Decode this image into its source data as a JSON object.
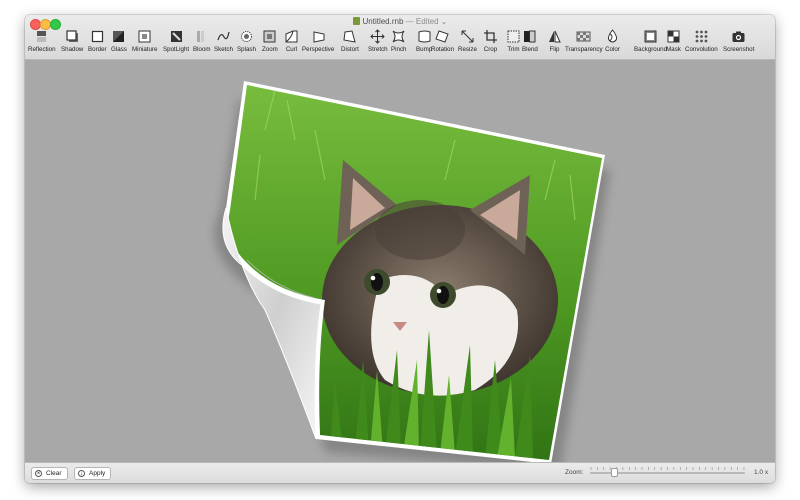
{
  "window": {
    "title": "Untitled.rnb",
    "status": "— Edited ⌄"
  },
  "toolbar": {
    "tools": [
      {
        "label": "Reflection",
        "icon": "reflection-icon"
      },
      {
        "label": "Shadow",
        "icon": "shadow-icon"
      },
      {
        "label": "Border",
        "icon": "border-icon"
      },
      {
        "label": "Glass",
        "icon": "glass-icon"
      },
      {
        "label": "Miniature",
        "icon": "miniature-icon"
      },
      {
        "label": "SpotLight",
        "icon": "spotlight-icon"
      },
      {
        "label": "Bloom",
        "icon": "bloom-icon"
      },
      {
        "label": "Sketch",
        "icon": "sketch-icon"
      },
      {
        "label": "Splash",
        "icon": "splash-icon"
      },
      {
        "label": "Zoom",
        "icon": "zoom-icon"
      },
      {
        "label": "Curl",
        "icon": "curl-icon"
      },
      {
        "label": "Perspective",
        "icon": "perspective-icon"
      },
      {
        "label": "Distort",
        "icon": "distort-icon"
      },
      {
        "label": "Stretch",
        "icon": "stretch-icon"
      },
      {
        "label": "Pinch",
        "icon": "pinch-icon"
      },
      {
        "label": "Bump",
        "icon": "bump-icon"
      },
      {
        "label": "Rotation",
        "icon": "rotation-icon"
      },
      {
        "label": "Resize",
        "icon": "resize-icon"
      },
      {
        "label": "Crop",
        "icon": "crop-icon"
      },
      {
        "label": "Trim",
        "icon": "trim-icon"
      },
      {
        "label": "Blend",
        "icon": "blend-icon"
      },
      {
        "label": "Flip",
        "icon": "flip-icon"
      },
      {
        "label": "Transparency",
        "icon": "transparency-icon"
      },
      {
        "label": "Color",
        "icon": "color-icon"
      },
      {
        "label": "Background",
        "icon": "background-icon"
      },
      {
        "label": "Mask",
        "icon": "mask-icon"
      },
      {
        "label": "Convolution",
        "icon": "convolution-icon"
      },
      {
        "label": "Screenshot",
        "icon": "screenshot-icon"
      }
    ]
  },
  "bottombar": {
    "clear_label": "Clear",
    "apply_label": "Apply",
    "zoom_label": "Zoom:",
    "zoom_value": "1.0 x",
    "zoom_fraction": 0.16
  },
  "colors": {
    "canvas": "#a8a8a8",
    "grass": "#4f9a23",
    "accent_close": "#fc605b",
    "accent_min": "#fdbc40",
    "accent_max": "#34c84a"
  }
}
